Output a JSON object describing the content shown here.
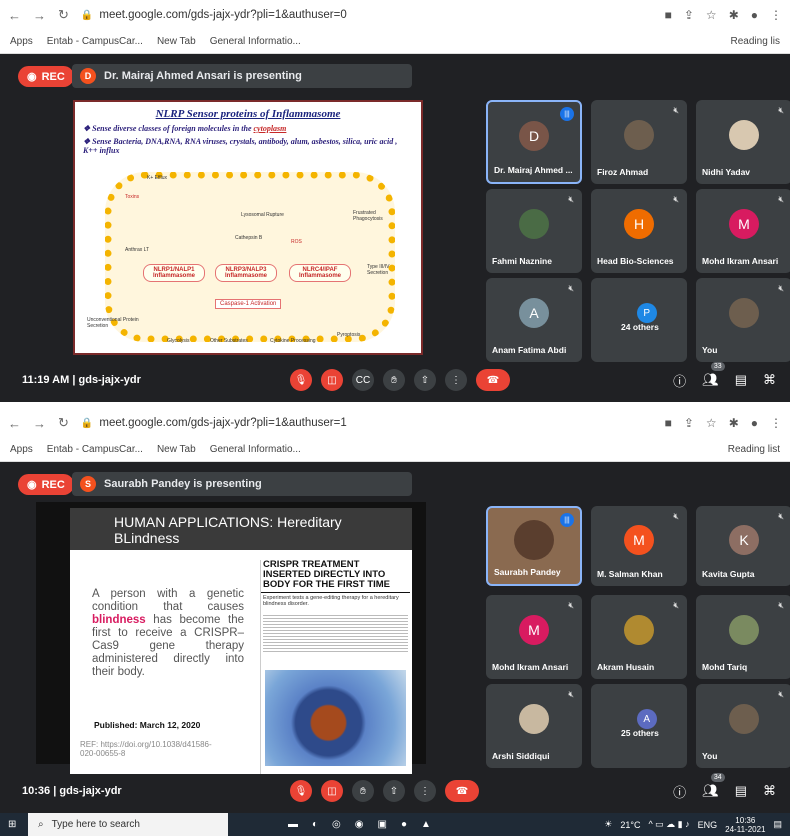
{
  "top": {
    "url": "meet.google.com/gds-jajx-ydr?pli=1&authuser=0",
    "bookmarks": [
      "Apps",
      "Entab - CampusCar...",
      "New Tab",
      "General Informatio..."
    ],
    "reading_list": "Reading lis",
    "rec": "REC",
    "presenter_initial": "D",
    "presenter_banner": "Dr. Mairaj Ahmed Ansari is presenting",
    "slide": {
      "title": "NLRP Sensor proteins of Inflammasome",
      "bullet1_a": "Sense diverse classes of foreign molecules in the ",
      "bullet1_b": "cytoplasm",
      "bullet2": "Sense Bacteria, DNA,RNA, RNA viruses, crystals, antibody, alum, asbestos, silica, uric acid , K++ influx",
      "inf1": "NLRP1/NALP1 Inflammasome",
      "inf2": "NLRP3/NALP3 Inflammasome",
      "inf3": "NLRC4/IPAF Inflammasome",
      "caspase": "Caspase-1 Activation",
      "lbl_frustrated": "Frustrated Phagocytosis",
      "lbl_lysosomal": "Lysosomal Rupture",
      "lbl_unconv": "Unconventional Protein Secretion",
      "lbl_glycolysis": "Glycolysis",
      "lbl_other": "Other Substrates",
      "lbl_cytokine": "Cytokine Processing",
      "lbl_pyroptosis": "Pyroptosis",
      "lbl_typeiii": "Type III/IV Secretion",
      "lbl_anthrax": "Anthrax LT",
      "lbl_toxins": "Toxins",
      "lbl_k": "K+ Efflux",
      "lbl_ros": "ROS",
      "lbl_cathepsin": "Cathepsin B"
    },
    "tiles": [
      {
        "name": "Dr. Mairaj Ahmed ...",
        "initial": "D",
        "color": "#795548",
        "photo": false,
        "active": true
      },
      {
        "name": "Firoz Ahmad",
        "initial": "",
        "color": "#6d5e4e",
        "photo": true
      },
      {
        "name": "Nidhi Yadav",
        "initial": "",
        "color": "#d8c8b0",
        "photo": true
      },
      {
        "name": "Fahmi Naznine",
        "initial": "",
        "color": "#4a6b45",
        "photo": true
      },
      {
        "name": "Head Bio-Sciences",
        "initial": "H",
        "color": "#ef6c00",
        "photo": false
      },
      {
        "name": "Mohd Ikram Ansari",
        "initial": "M",
        "color": "#d81b60",
        "photo": false
      },
      {
        "name": "Anam Fatima Abdi",
        "initial": "A",
        "color": "#78909c",
        "photo": false
      },
      {
        "name": "24 others",
        "initial": "P",
        "color": "#1e88e5",
        "photo": false
      },
      {
        "name": "You",
        "initial": "",
        "color": "#6d4c41",
        "photo": true
      }
    ],
    "time": "11:19 AM",
    "meeting_code": "gds-jajx-ydr",
    "people_count": "33"
  },
  "bottom": {
    "url": "meet.google.com/gds-jajx-ydr?pli=1&authuser=1",
    "bookmarks": [
      "Apps",
      "Entab - CampusCar...",
      "New Tab",
      "General Informatio..."
    ],
    "reading_list": "Reading list",
    "rec": "REC",
    "presenter_initial": "S",
    "presenter_banner": "Saurabh Pandey is presenting",
    "slide": {
      "header": "HUMAN APPLICATIONS: Hereditary BLindness",
      "body_a": "A person with a genetic condition that causes ",
      "body_b": "blindness",
      "body_c": " has become the first to receive a CRISPR–Cas9 gene therapy administered directly into their body.",
      "published": "Published: March 12, 2020",
      "ref": "REF: https://doi.org/10.1038/d41586-020-00655-8",
      "mag_title": "CRISPR TREATMENT INSERTED DIRECTLY INTO BODY FOR THE FIRST TIME",
      "mag_sub": "Experiment tests a gene-editing therapy for a hereditary blindness disorder."
    },
    "tiles": [
      {
        "name": "Saurabh Pandey",
        "initial": "",
        "color": "#8a6a50",
        "photo": true,
        "active": true
      },
      {
        "name": "M. Salman Khan",
        "initial": "M",
        "color": "#f4511e",
        "photo": false
      },
      {
        "name": "Kavita Gupta",
        "initial": "K",
        "color": "#8d6e63",
        "photo": false
      },
      {
        "name": "Mohd Ikram Ansari",
        "initial": "M",
        "color": "#d81b60",
        "photo": false
      },
      {
        "name": "Akram Husain",
        "initial": "",
        "color": "#b08a30",
        "photo": true
      },
      {
        "name": "Mohd Tariq",
        "initial": "",
        "color": "#7a8a60",
        "photo": true
      },
      {
        "name": "Arshi Siddiqui",
        "initial": "",
        "color": "#c8b8a0",
        "photo": true
      },
      {
        "name": "25 others",
        "initial": "A",
        "color": "#5c6bc0",
        "photo": false
      },
      {
        "name": "You",
        "initial": "",
        "color": "#6d4c41",
        "photo": true
      }
    ],
    "time": "10:36",
    "meeting_code": "gds-jajx-ydr",
    "people_count": "34"
  },
  "taskbar": {
    "search_placeholder": "Type here to search",
    "weather": "21°C",
    "lang": "ENG",
    "clock_time": "10:36",
    "clock_date": "24-11-2021"
  }
}
